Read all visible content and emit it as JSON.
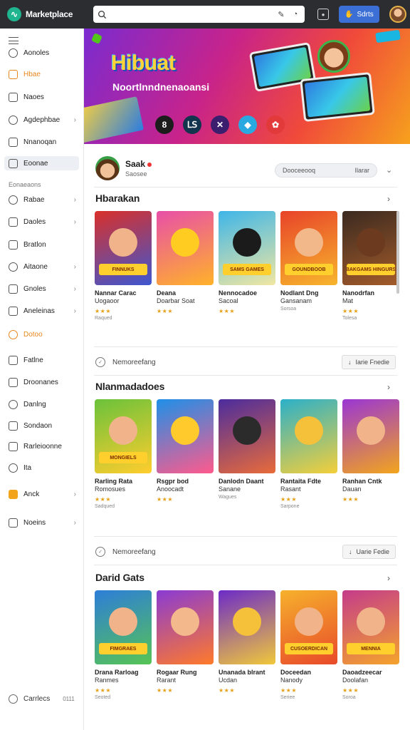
{
  "app": {
    "name": "Marketplace"
  },
  "topbar": {
    "search_placeholder": "",
    "button_label": "Sdrts"
  },
  "sidebar": {
    "items": [
      {
        "label": "Aonoles",
        "icon": "search-icon",
        "chevron": false
      },
      {
        "label": "Hbae",
        "icon": "home-icon",
        "chevron": false,
        "style": "orange"
      },
      {
        "label": "Naoes",
        "icon": "cloud-icon",
        "chevron": false
      },
      {
        "label": "Agdephbae",
        "icon": "music-icon",
        "chevron": true
      },
      {
        "label": "Nnanoqan",
        "icon": "monitor-icon",
        "chevron": false
      },
      {
        "label": "Eoonae",
        "icon": "disc-icon",
        "chevron": false,
        "style": "active"
      },
      {
        "label": "Rabae",
        "icon": "bag-icon",
        "chevron": true
      },
      {
        "label": "Daoles",
        "icon": "grid-icon",
        "chevron": true
      },
      {
        "label": "Bratlon",
        "icon": "bubble-icon",
        "chevron": false
      },
      {
        "label": "Aitaone",
        "icon": "box-icon",
        "chevron": true
      },
      {
        "label": "Gnoles",
        "icon": "pen-icon",
        "chevron": true
      },
      {
        "label": "Aneleinas",
        "icon": "card-icon",
        "chevron": true
      },
      {
        "label": "Dotoo",
        "icon": "chart-icon",
        "chevron": false,
        "style": "orange"
      },
      {
        "label": "Fatlne",
        "icon": "image-icon",
        "chevron": false
      },
      {
        "label": "Droonanes",
        "icon": "clock-icon",
        "chevron": false
      },
      {
        "label": "Danlng",
        "icon": "file-icon",
        "chevron": false
      },
      {
        "label": "Sondaon",
        "icon": "cast-icon",
        "chevron": false
      },
      {
        "label": "Rarleioonne",
        "icon": "square-icon",
        "chevron": false
      },
      {
        "label": "Ita",
        "icon": "search-icon",
        "chevron": false
      },
      {
        "label": "Anck",
        "icon": "star-icon",
        "chevron": true,
        "style": "filled"
      },
      {
        "label": "Noeins",
        "icon": "tag-icon",
        "chevron": true
      }
    ],
    "section_label": "Eonaeaons",
    "footer": {
      "label": "Carrlecs",
      "version": "0111"
    }
  },
  "hero": {
    "title": "Hibuat",
    "subtitle": "Noortlnndnenaoansi",
    "icons": [
      {
        "glyph": "8",
        "color": "#1c1c1c"
      },
      {
        "glyph": "ᒪꓢ",
        "color": "#12344d"
      },
      {
        "glyph": "✕",
        "color": "#3b1f6e"
      },
      {
        "glyph": "◆",
        "color": "#2aa8e0"
      },
      {
        "glyph": "✿",
        "color": "#e23a3a"
      }
    ]
  },
  "profile": {
    "name": "Saak",
    "subtitle": "Saosee",
    "field_left": "Dooceeooq",
    "field_right": "Ilarar"
  },
  "sections": [
    {
      "title": "Hbarakan",
      "cards": [
        {
          "title": "Nannar Carac",
          "sub": "Uogaoor",
          "rating": "★★★",
          "meta": "Raqued",
          "banner": "FINNUKS",
          "bg": "#d9302a,#3e57d0",
          "face": "#f1b48a"
        },
        {
          "title": "Deana",
          "sub": "Doarbar Soat",
          "rating": "★★★",
          "meta": "",
          "banner": "",
          "bg": "#e84fa8,#ffb22a",
          "face": "#ffcc21"
        },
        {
          "title": "Nennocadoe",
          "sub": "Sacoal",
          "rating": "★★★",
          "meta": "",
          "banner": "SAMS GAMES",
          "bg": "#3fb6e8,#f0e7a2",
          "face": "#1b1b1b"
        },
        {
          "title": "Nodlant Dng",
          "sub": "Gansanam",
          "rating": "",
          "meta": "Sorsoa",
          "banner": "GOUNDBOOB",
          "bg": "#e8432a,#f7b52c",
          "face": "#f2b889"
        },
        {
          "title": "Nanodrfan",
          "sub": "Mat",
          "rating": "★★★",
          "meta": "Tolesa",
          "banner": "BAKGAMS HINGURS",
          "bg": "#3b2a20,#a35b2a",
          "face": "#6b3a1f"
        }
      ],
      "feature": {
        "label": "Nemoreefang",
        "button": "Iarie Fnedie"
      }
    },
    {
      "title": "Nlanmadadoes",
      "cards": [
        {
          "title": "Rarling Rata",
          "sub": "Romosues",
          "rating": "★★★",
          "meta": "Sadqued",
          "banner": "MONGIELS",
          "bg": "#6ac23b,#ffcd2e",
          "face": "#f1b48a"
        },
        {
          "title": "Rsgpr bod",
          "sub": "Anoocadt",
          "rating": "★★★",
          "meta": "",
          "banner": "",
          "bg": "#1e90e8,#ff5a8c",
          "face": "#ffcb2c"
        },
        {
          "title": "Danlodn Daant",
          "sub": "Sanane",
          "rating": "",
          "meta": "Wagues",
          "banner": "",
          "bg": "#4b2c9e,#e86b3a",
          "face": "#2b2b2b"
        },
        {
          "title": "Rantaita Fdte",
          "sub": "Rasant",
          "rating": "★★★",
          "meta": "Sarpone",
          "banner": "",
          "bg": "#2bb0c9,#f4cf3a",
          "face": "#f5c13a"
        },
        {
          "title": "Ranhan Cntk",
          "sub": "Dauan",
          "rating": "★★★",
          "meta": "",
          "banner": "",
          "bg": "#9a36d4,#f2a51c",
          "face": "#f1b48a"
        }
      ],
      "feature": {
        "label": "Nemoreefang",
        "button": "Uarie Fedie"
      }
    },
    {
      "title": "Darid Gats",
      "cards": [
        {
          "title": "Drana Rarloag",
          "sub": "Ranmes",
          "rating": "★★★",
          "meta": "Seoted",
          "banner": "FIMGRAES",
          "bg": "#2d7ed8,#56c455",
          "face": "#f1b48a"
        },
        {
          "title": "Rogaar Rung",
          "sub": "Rarant",
          "rating": "★★★",
          "meta": "",
          "banner": "",
          "bg": "#8a3bd4,#ff7a2a",
          "face": "#f3b98c"
        },
        {
          "title": "Unanada blrant",
          "sub": "Ucdan",
          "rating": "★★★",
          "meta": "",
          "banner": "",
          "bg": "#6c2bc8,#f0c83a",
          "face": "#f5c13a"
        },
        {
          "title": "Doceedan",
          "sub": "Nanody",
          "rating": "★★★",
          "meta": "Seriee",
          "banner": "CUSOERDICAN",
          "bg": "#f6b12c,#e84a2a",
          "face": "#f1b48a"
        },
        {
          "title": "Daoadzeecar",
          "sub": "Doolafan",
          "rating": "★★★",
          "meta": "Soroa",
          "banner": "MENNIA",
          "bg": "#c43c8a,#f4a32c",
          "face": "#f1b48a"
        }
      ],
      "feature": null
    }
  ],
  "colors": {
    "accent": "#3b6fd6",
    "orange": "#e8871e",
    "topbar": "#2b2d31"
  }
}
